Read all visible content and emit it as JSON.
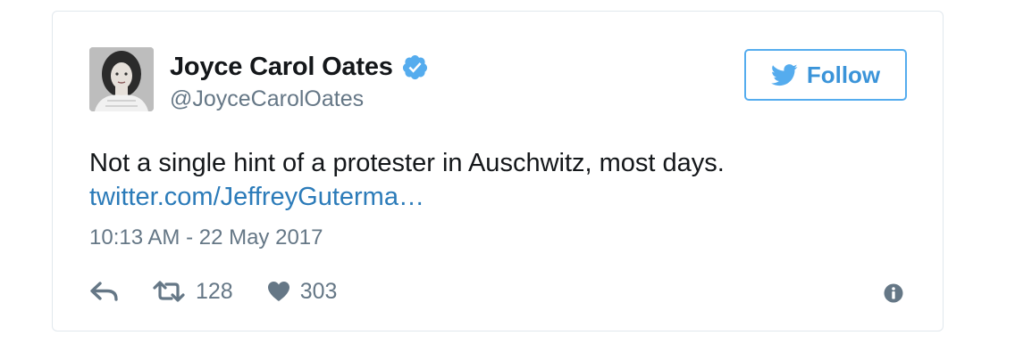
{
  "author": {
    "display_name": "Joyce Carol Oates",
    "handle": "@JoyceCarolOates",
    "verified": true,
    "avatar_icon": "avatar-photo"
  },
  "follow_button": {
    "label": "Follow",
    "icon": "twitter-bird-icon"
  },
  "tweet": {
    "text": "Not a single hint of a protester in Auschwitz, most days.",
    "link": "twitter.com/JeffreyGuterma…",
    "timestamp": "10:13 AM - 22 May 2017"
  },
  "actions": {
    "reply_icon": "reply-icon",
    "retweet_count": "128",
    "like_count": "303",
    "info_icon": "info-icon"
  },
  "colors": {
    "accent": "#55acee",
    "link": "#2b7bb9",
    "text": "#14171a",
    "muted": "#657786",
    "border": "#e1e8ed"
  }
}
